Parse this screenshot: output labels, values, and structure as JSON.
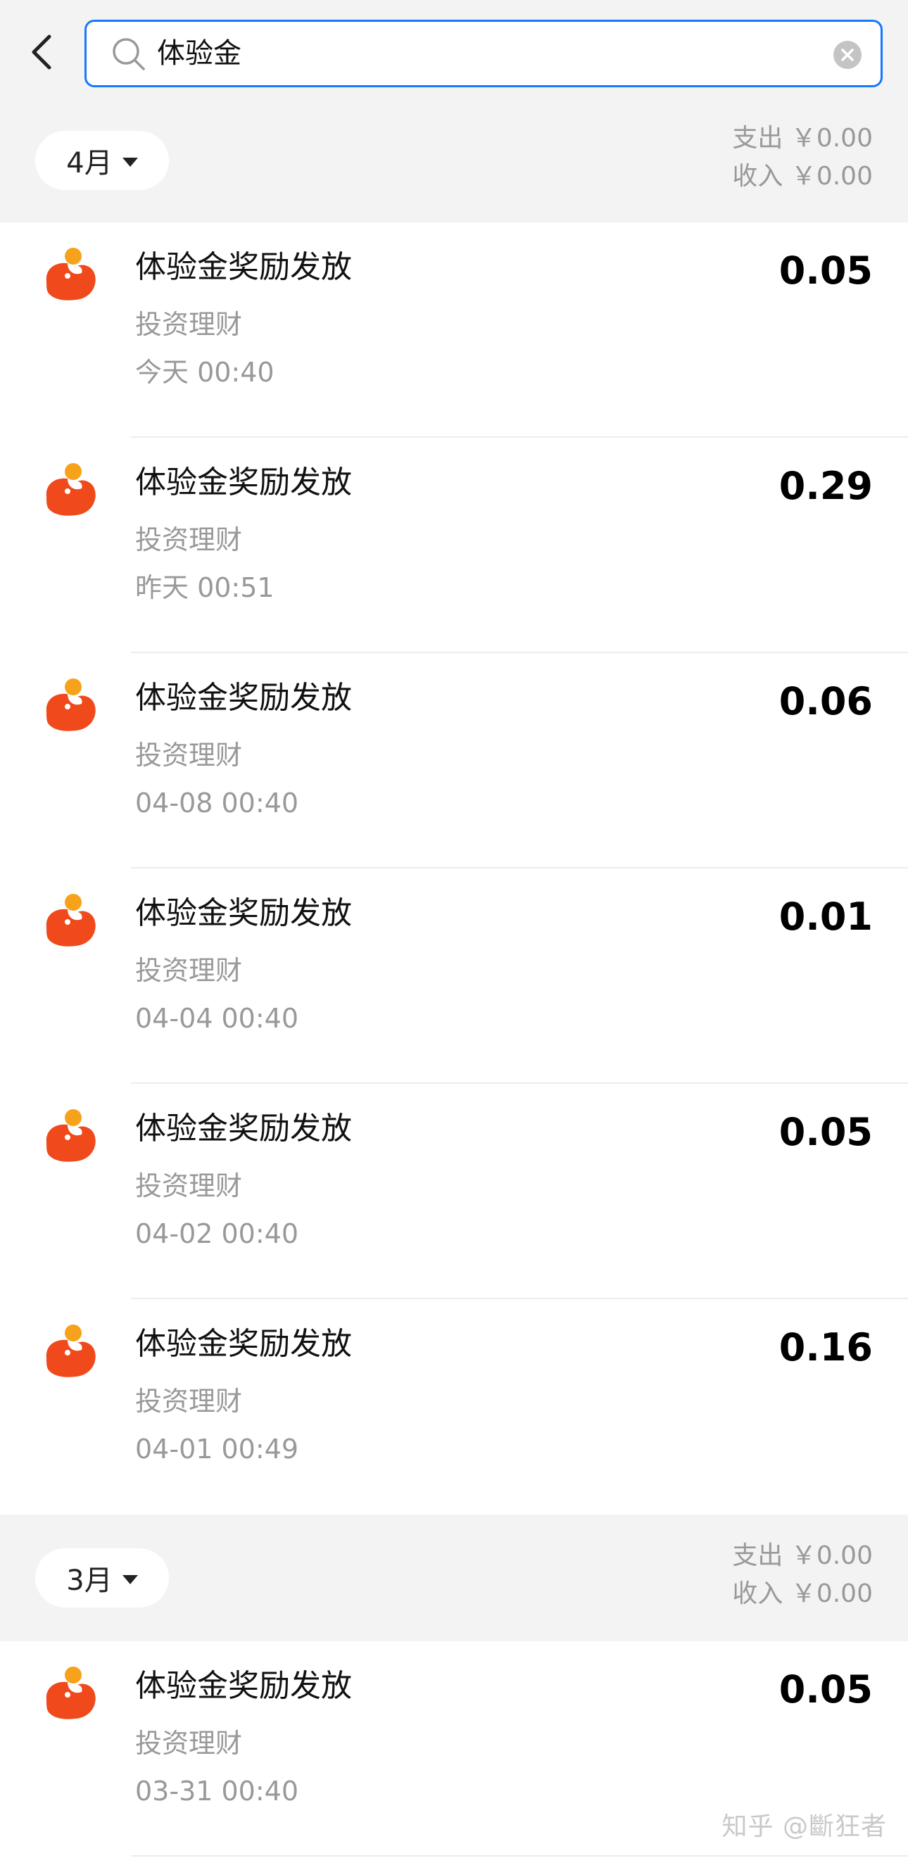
{
  "search": {
    "value": "体验金"
  },
  "sections": [
    {
      "month": "4月",
      "expense_label": "支出 ￥0.00",
      "income_label": "收入 ￥0.00",
      "transactions": [
        {
          "title": "体验金奖励发放",
          "category": "投资理财",
          "time": "今天 00:40",
          "amount": "0.05"
        },
        {
          "title": "体验金奖励发放",
          "category": "投资理财",
          "time": "昨天 00:51",
          "amount": "0.29"
        },
        {
          "title": "体验金奖励发放",
          "category": "投资理财",
          "time": "04-08 00:40",
          "amount": "0.06"
        },
        {
          "title": "体验金奖励发放",
          "category": "投资理财",
          "time": "04-04 00:40",
          "amount": "0.01"
        },
        {
          "title": "体验金奖励发放",
          "category": "投资理财",
          "time": "04-02 00:40",
          "amount": "0.05"
        },
        {
          "title": "体验金奖励发放",
          "category": "投资理财",
          "time": "04-01 00:49",
          "amount": "0.16"
        }
      ]
    },
    {
      "month": "3月",
      "expense_label": "支出 ￥0.00",
      "income_label": "收入 ￥0.00",
      "transactions": [
        {
          "title": "体验金奖励发放",
          "category": "投资理财",
          "time": "03-31 00:40",
          "amount": "0.05"
        }
      ]
    }
  ],
  "watermark": "知乎 @斷狂者",
  "colors": {
    "accent": "#1677ff",
    "logo_primary": "#f04a1c",
    "logo_dot": "#f7a21b",
    "muted_text": "#999999",
    "background": "#f3f3f3"
  },
  "icons": {
    "back": "chevron-left-icon",
    "search": "search-icon",
    "clear": "clear-icon",
    "month_dropdown": "caret-down-icon",
    "merchant_logo": "fund-logo-icon"
  }
}
